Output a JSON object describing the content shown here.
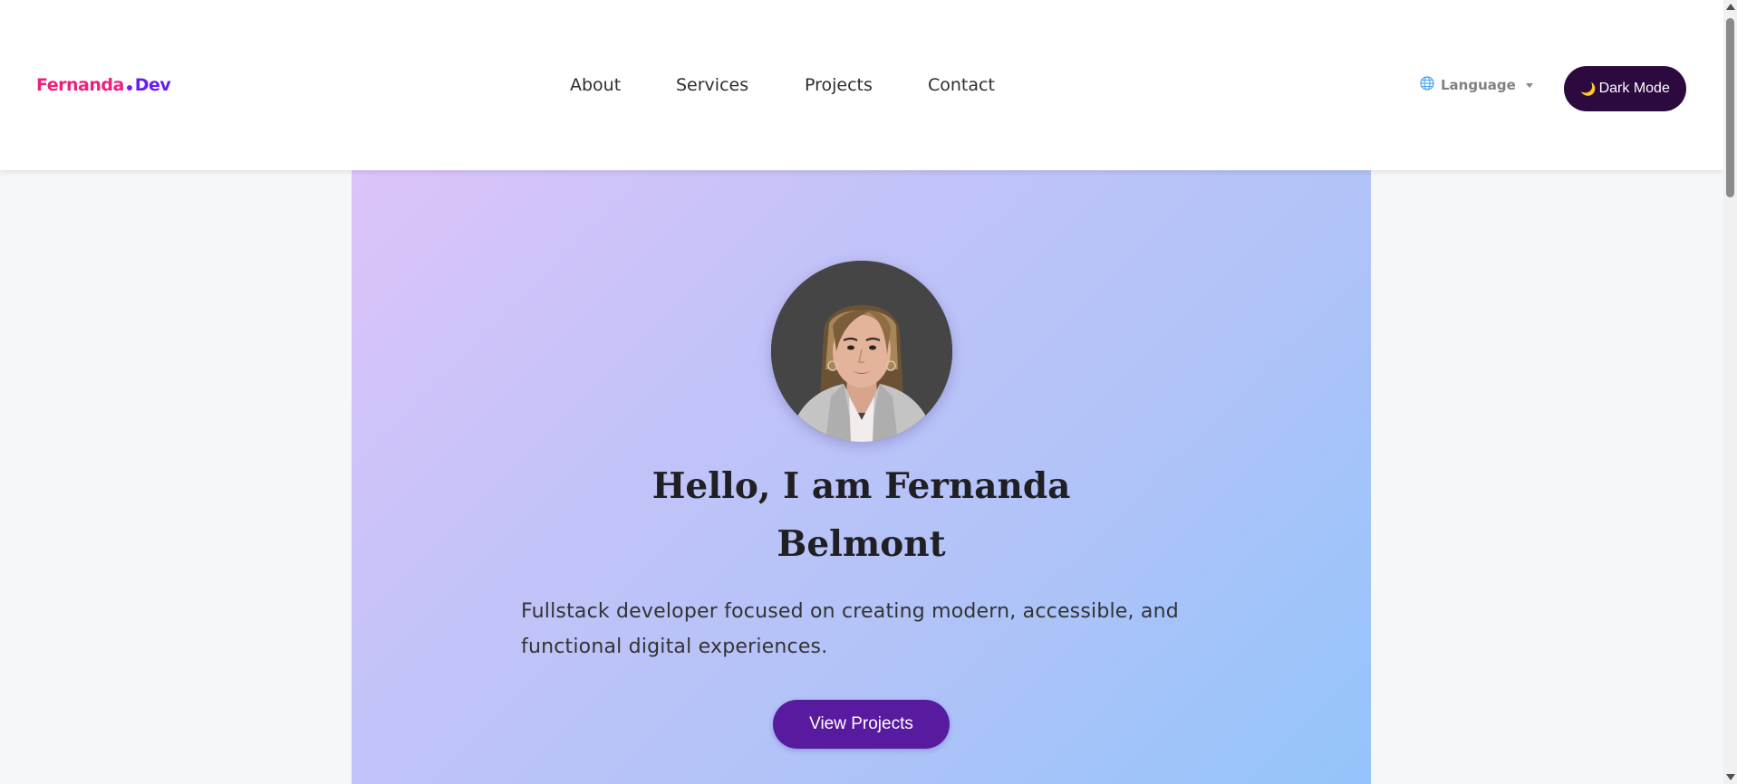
{
  "header": {
    "logo": {
      "first": "Fernanda",
      "second": "Dev"
    },
    "nav": [
      "About",
      "Services",
      "Projects",
      "Contact"
    ],
    "language_label": "Language",
    "dark_mode_label": "Dark Mode"
  },
  "hero": {
    "headline_line1": "Hello, I am Fernanda",
    "headline_line2": "Belmont",
    "tagline": "Fullstack developer focused on creating modern, accessible, and functional digital experiences.",
    "cta_label": "View Projects"
  },
  "icons": {
    "language": "globe-icon",
    "dark_mode": "moon-icon",
    "dropdown": "caret-down-icon"
  },
  "colors": {
    "logo_primary": "#ef1f7d",
    "logo_secondary": "#6a1cf0",
    "dark_button": "#2c0a40",
    "cta_button": "#581a9f",
    "hero_gradient_start": "#dcc3fb",
    "hero_gradient_end": "#93c4fb"
  }
}
